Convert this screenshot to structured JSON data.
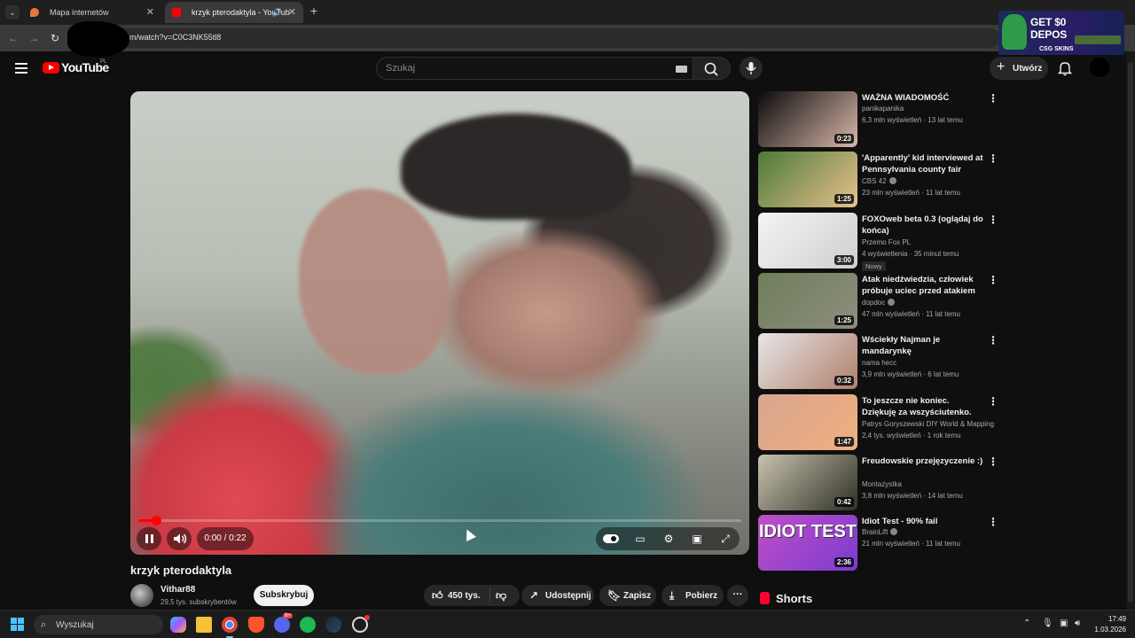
{
  "browser": {
    "tabs": [
      {
        "title": "Mapa internetów",
        "active": false,
        "favicon": "map-pin-icon"
      },
      {
        "title": "krzyk pterodaktyla - YouTub",
        "active": true,
        "favicon": "youtube-icon"
      }
    ],
    "url": "m/watch?v=C0C3NK55tl8",
    "ad": {
      "line1": "GET $0",
      "line1b": "DEPOS",
      "line2": "CSG SKINS"
    }
  },
  "header": {
    "logo": "YouTube",
    "region": "PL",
    "search_placeholder": "Szukaj",
    "create_label": "Utwórz"
  },
  "player": {
    "time": "0:00 / 0:22",
    "progress": 0.03
  },
  "video": {
    "title": "krzyk pterodaktyla",
    "channel": "Vithar88",
    "subscribers": "29,5 tys. subskrybentów",
    "subscribe_label": "Subskrybuj",
    "likes": "450 tys.",
    "share_label": "Udostępnij",
    "save_label": "Zapisz",
    "download_label": "Pobierz"
  },
  "recommendations": [
    {
      "title": "WAŻNA WIADOMOŚĆ",
      "channel": "panikapanika",
      "meta": "6,3 mln wyświetleń · 13 lat temu",
      "duration": "0:23",
      "verified": false,
      "colors": [
        "#0b0b0b",
        "#d9b7a9"
      ]
    },
    {
      "title": "'Apparently' kid interviewed at Pennsylvania county fair",
      "channel": "CBS 42",
      "meta": "23 mln wyświetleń · 11 lat temu",
      "duration": "1:25",
      "verified": true,
      "colors": [
        "#4c7a3a",
        "#e7c18c"
      ]
    },
    {
      "title": "FOXOweb beta 0.3 (oglądaj do końca)",
      "channel": "Przemo Fox PL",
      "meta": "4 wyświetlenia · 35 minut temu",
      "duration": "3:00",
      "verified": false,
      "badge": "Nowy",
      "colors": [
        "#f4f4f4",
        "#cfcfcf"
      ]
    },
    {
      "title": "Atak niedźwiedzia, człowiek próbuje uciec przed atakiem ...",
      "channel": "dopdoc",
      "meta": "47 mln wyświetleń · 11 lat temu",
      "duration": "1:25",
      "verified": true,
      "colors": [
        "#6f7f5a",
        "#8d8d7e"
      ]
    },
    {
      "title": "Wściekły Najman je mandarynkę",
      "channel": "nama hecc",
      "meta": "3,9 mln wyświetleń · 6 lat temu",
      "duration": "0:32",
      "verified": false,
      "colors": [
        "#e6e6e6",
        "#b07f6c"
      ]
    },
    {
      "title": "To jeszcze nie koniec. Dziękuję za wszyściutenko.",
      "channel": "Patrys Goryszewski DIY World & Mapping",
      "meta": "2,4 tys. wyświetleń · 1 rok temu",
      "duration": "1:47",
      "verified": false,
      "colors": [
        "#d9a58f",
        "#f0b07e"
      ]
    },
    {
      "title": "Freudowskie przejęzyczenie :)",
      "channel": "Montazystka",
      "meta": "3,8 mln wyświetleń · 14 lat temu",
      "duration": "0:42",
      "verified": false,
      "colors": [
        "#c9c2ae",
        "#2e3026"
      ]
    },
    {
      "title": "Idiot Test - 90% fail",
      "channel": "BrainLift",
      "meta": "21 mln wyświetleń · 11 lat temu",
      "duration": "2:36",
      "verified": true,
      "thumb_text": "IDIOT TEST",
      "colors": [
        "#c04fc5",
        "#7a3bd1"
      ]
    }
  ],
  "shorts_label": "Shorts",
  "taskbar": {
    "search_placeholder": "Wyszukaj",
    "time": "17:49",
    "date": "1.03.2026",
    "discord_badge": "9+"
  }
}
